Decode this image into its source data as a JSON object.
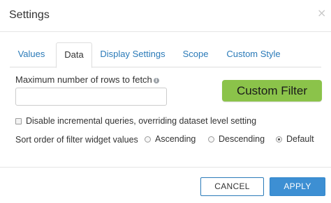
{
  "dialog": {
    "title": "Settings",
    "close_glyph": "×"
  },
  "tabs": [
    {
      "label": "Values",
      "active": false
    },
    {
      "label": "Data",
      "active": true
    },
    {
      "label": "Display Settings",
      "active": false
    },
    {
      "label": "Scope",
      "active": false
    },
    {
      "label": "Custom Style",
      "active": false
    }
  ],
  "form": {
    "max_rows_label": "Maximum number of rows to fetch",
    "info_glyph": "i",
    "max_rows_value": "",
    "custom_filter_label": "Custom Filter",
    "custom_filter_color": "#8bc34a",
    "disable_incremental_label": "Disable incremental queries, overriding dataset level setting",
    "disable_incremental_checked": false,
    "sort_label": "Sort order of filter widget values",
    "sort_options": [
      {
        "label": "Ascending",
        "checked": false
      },
      {
        "label": "Descending",
        "checked": false
      },
      {
        "label": "Default",
        "checked": true
      }
    ]
  },
  "footer": {
    "cancel_label": "CANCEL",
    "apply_label": "APPLY",
    "apply_color": "#3d8fd3"
  }
}
